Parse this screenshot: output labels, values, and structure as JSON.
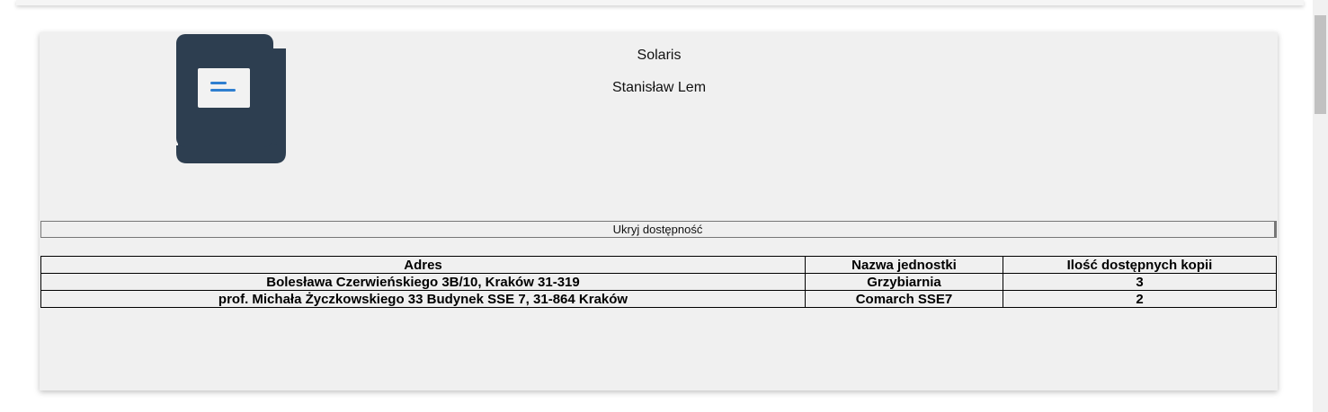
{
  "book": {
    "title": "Solaris",
    "author": "Stanisław Lem",
    "icon": "book-icon"
  },
  "availability": {
    "toggle_label": "Ukryj dostępność",
    "columns": [
      "Adres",
      "Nazwa jednostki",
      "Ilość dostępnych kopii"
    ],
    "rows": [
      {
        "address": "Bolesława Czerwieńskiego 3B/10, Kraków 31-319",
        "unit": "Grzybiarnia",
        "copies": "3"
      },
      {
        "address": "prof. Michała Życzkowskiego 33 Budynek SSE 7, 31-864 Kraków",
        "unit": "Comarch SSE7",
        "copies": "2"
      }
    ]
  },
  "colors": {
    "icon_dark": "#2d3e50",
    "icon_page": "#f2f2f2",
    "icon_lines": "#2f7fd0",
    "card_bg": "#f0f0f0"
  }
}
